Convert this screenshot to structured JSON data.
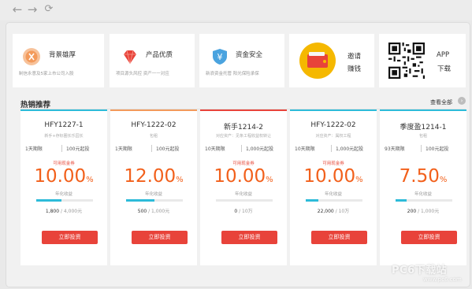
{
  "browser": {
    "back_icon": "arrow-left-icon",
    "forward_icon": "arrow-right-icon",
    "refresh_icon": "refresh-icon"
  },
  "features": [
    {
      "title": "背景雄厚",
      "desc": "制信永意及5家上市公司入股",
      "icon": "medal-icon",
      "color": "#f39a5b"
    },
    {
      "title": "产品优质",
      "desc": "项目源头风控 资产一一对应",
      "icon": "diamond-icon",
      "color": "#e8433a"
    },
    {
      "title": "资金安全",
      "desc": "新浪资金托管 阳光保险承保",
      "icon": "shield-yuan-icon",
      "color": "#4aa3df"
    },
    {
      "title": "邀请",
      "title2": "赚钱",
      "icon": "wallet-icon",
      "color": "#f5b800"
    },
    {
      "title": "APP",
      "title2": "下载",
      "icon": "qr-code-icon"
    }
  ],
  "section": {
    "title": "热销推荐",
    "see_all": "查看全部",
    "see_all_icon": "chevron-right-icon"
  },
  "products": [
    {
      "name": "HFY1227-1",
      "tag": "新手+存标圈长乐园长",
      "term": "1天期限",
      "min": "100元起投",
      "coupon": "可用现金券",
      "rate": "10.00",
      "pct": "%",
      "rate_label": "年化收益",
      "sold": "1,800",
      "total": "/ 4,000元",
      "progress": 0.45,
      "button": "立即投资",
      "line_color": "#2dbbd9"
    },
    {
      "name": "HFY-1222-02",
      "tag": "包租",
      "term": "1天期限",
      "min": "100元起投",
      "coupon": "",
      "rate": "12.00",
      "pct": "%",
      "rate_label": "年化收益",
      "sold": "500",
      "total": "/ 1,000元",
      "progress": 0.5,
      "button": "立即投资",
      "line_color": "#f39a5b"
    },
    {
      "name": "新手1214-2",
      "tag": "对应资产：见条工程收益权转让",
      "term": "10天期限",
      "min": "1,000元起投",
      "coupon": "可用现金券",
      "rate": "10.00",
      "pct": "%",
      "rate_label": "年化收益",
      "sold": "0",
      "total": "/ 10万",
      "progress": 0,
      "button": "立即投资",
      "line_color": "#e8433a"
    },
    {
      "name": "HFY-1222-02",
      "tag": "对应资产：属权工程",
      "term": "10天期限",
      "min": "1,000元起投",
      "coupon": "可用现金券",
      "rate": "10.00",
      "pct": "%",
      "rate_label": "年化收益",
      "sold": "22,000",
      "total": "/ 10万",
      "progress": 0.22,
      "button": "立即投资",
      "line_color": "#2dbbd9"
    },
    {
      "name": "季度盈1214-1",
      "tag": "包租",
      "term": "93天期限",
      "min": "100元起投",
      "coupon": "",
      "rate": "7.50",
      "pct": "%",
      "rate_label": "年化收益",
      "sold": "200",
      "total": "/ 1,000元",
      "progress": 0.2,
      "button": "立即投资",
      "line_color": "#2dbbd9"
    }
  ],
  "watermark": {
    "brand": "PC6下载站",
    "url": "www.pc6.com"
  }
}
